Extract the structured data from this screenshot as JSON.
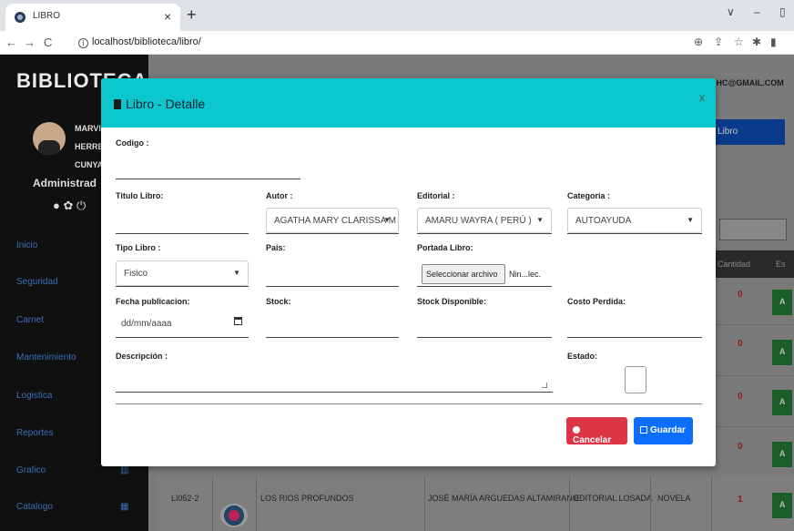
{
  "browser": {
    "tab_title": "LIBRO",
    "tab_close": "×",
    "new_tab": "+",
    "url": "localhost/biblioteca/libro/",
    "window_controls": [
      "∨",
      "–",
      "▯"
    ],
    "nav": [
      "←",
      "→",
      "C"
    ]
  },
  "sidebar": {
    "brand": "BIBLIOTECA",
    "user_lines": [
      "MARVIN",
      "HERRERA",
      "CUNYARA"
    ],
    "role": "Administrad",
    "menu": [
      "Inicio",
      "Seguridad",
      "Carnet",
      "Mantenimiento",
      "Logistica",
      "Reportes",
      "Grafico",
      "Catalogo"
    ]
  },
  "header": {
    "email": "NHC@GMAIL.COM",
    "libro_button": "Libro"
  },
  "table": {
    "headers": [
      "Cantidad",
      "Es"
    ],
    "quantities": [
      "0",
      "0",
      "0",
      "0",
      "1"
    ],
    "action_label": "A",
    "last_row": {
      "code": "LI052-2",
      "title": "LOS RIOS PROFUNDOS",
      "author": "JOSÉ MARÍA ARGUEDAS ALTAMIRANO",
      "editorial": "EDITORIAL LOSADA",
      "category": "NOVELA",
      "qty": "1"
    }
  },
  "modal": {
    "title": "Libro - Detalle",
    "close": "x",
    "labels": {
      "codigo": "Codigo :",
      "titulo": "Titulo Libro:",
      "autor": "Autor :",
      "editorial": "Editorial :",
      "categoria": "Categoria :",
      "tipo": "Tipo Libro :",
      "pais": "Pais:",
      "portada": "Portada Libro:",
      "fecha": "Fecha publicacion:",
      "stock": "Stock:",
      "stock_disp": "Stock Disponible:",
      "costo": "Costo Perdida:",
      "descripcion": "Descripción :",
      "estado": "Estado:"
    },
    "values": {
      "autor": "AGATHA MARY CLARISSA M",
      "editorial": "AMARU WAYRA ( PERÚ )",
      "categoria": "AUTOAYUDA",
      "tipo": "Fisico",
      "file_button": "Seleccionar archivo",
      "file_status": "Nin...lec.",
      "fecha_placeholder": "dd/mm/aaaa"
    },
    "buttons": {
      "cancel": "Cancelar",
      "save": "Guardar"
    }
  }
}
